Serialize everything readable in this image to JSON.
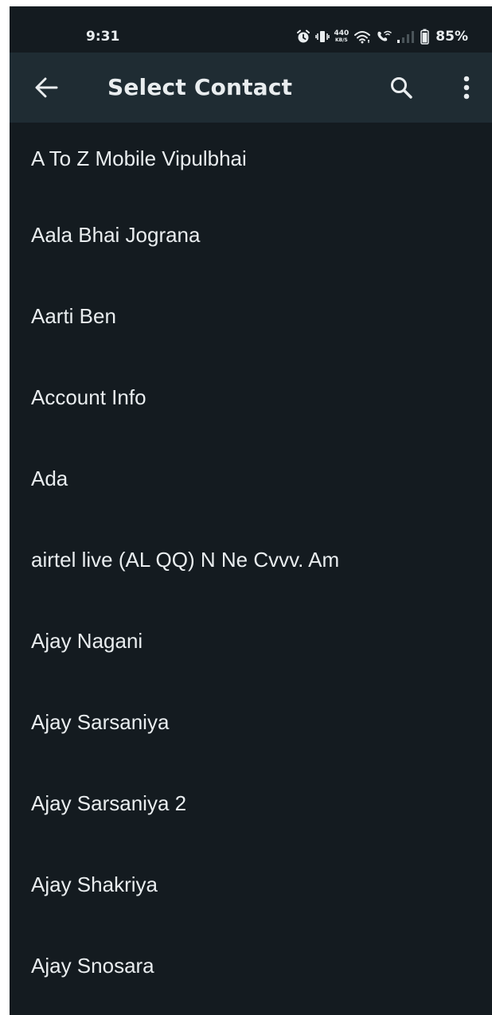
{
  "status_bar": {
    "time": "9:31",
    "net_speed_value": "440",
    "net_speed_unit": "KB/S",
    "battery_percent": "85%",
    "icons": [
      "alarm-icon",
      "vibrate-icon",
      "wifi-icon",
      "wifi-calling-icon",
      "signal-icon",
      "battery-icon"
    ]
  },
  "app_bar": {
    "title": "Select Contact",
    "icons": [
      "back-arrow-icon",
      "search-icon",
      "more-vert-icon"
    ]
  },
  "contacts": [
    "A To Z Mobile Vipulbhai",
    "Aala Bhai Jograna",
    "Aarti Ben",
    "Account Info",
    "Ada",
    "airtel live (AL QQ) N Ne Cvvv. Am",
    "Ajay Nagani",
    "Ajay Sarsaniya",
    "Ajay Sarsaniya 2",
    "Ajay Shakriya",
    "Ajay Snosara"
  ],
  "colors": {
    "background": "#141b20",
    "app_bar": "#1f2c33",
    "text": "#e9edef"
  }
}
